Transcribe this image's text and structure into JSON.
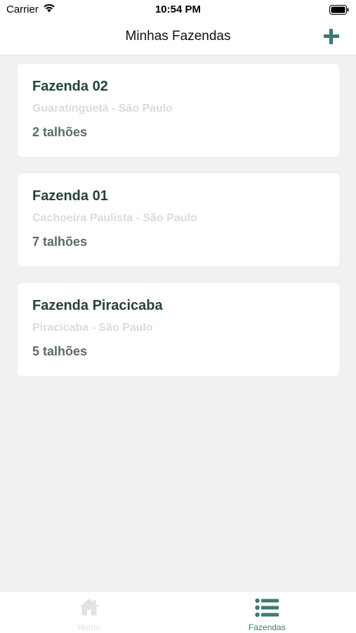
{
  "status_bar": {
    "carrier": "Carrier",
    "time": "10:54 PM",
    "icons": [
      "wifi-icon",
      "battery-icon"
    ]
  },
  "nav": {
    "title": "Minhas Fazendas",
    "add_icon": "plus-icon"
  },
  "farms": [
    {
      "name": "Fazenda 02",
      "location": "Guaratinguetá - São Paulo",
      "plots": "2 talhões"
    },
    {
      "name": "Fazenda 01",
      "location": "Cachoeira Paulista - São Paulo",
      "plots": "7 talhões"
    },
    {
      "name": "Fazenda Piracicaba",
      "location": "Piracicaba - São Paulo",
      "plots": "5 talhões"
    }
  ],
  "tabs": [
    {
      "label": "Home",
      "icon": "home-icon",
      "active": false
    },
    {
      "label": "Fazendas",
      "icon": "list-icon",
      "active": true
    }
  ],
  "colors": {
    "accent": "#3d7a72",
    "title_text": "#25423d",
    "location_text": "#d7ddda",
    "count_text": "#5b6b66",
    "background": "#f1f1f1"
  }
}
